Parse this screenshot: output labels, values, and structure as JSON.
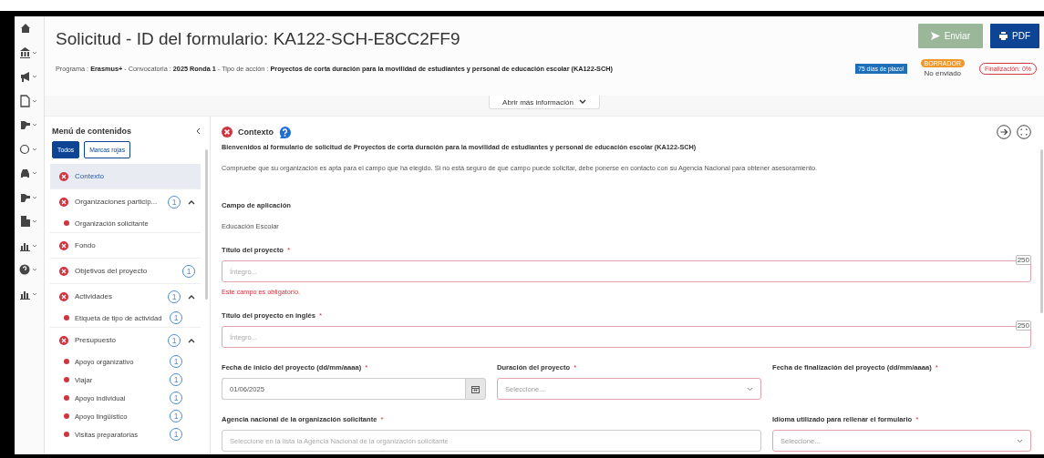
{
  "page": {
    "title": "Solicitud - ID del formulario: KA122-SCH-E8CC2FF9"
  },
  "actions": [
    {
      "label": "Enviar",
      "kind": "send",
      "disabled": true
    },
    {
      "label": "PDF",
      "kind": "pdf",
      "disabled": false
    }
  ],
  "info_line": "Programa : **Erasmus+** - Convocatoria : **2025 Ronda 1** - Tipo de acción : **Proyectos de corta duración para la movilidad de estudiantes y personal de educación escolar (KA122-SCH)**",
  "deadline_badge": "75 días de plazo!",
  "status": {
    "badge": "BORRADOR",
    "text": "No enviado"
  },
  "completion": "Finalización: 0%",
  "more_info_button": "Abrir más información",
  "menu": {
    "title": "Menú de contenidos",
    "filters": [
      {
        "label": "Todos",
        "selected": true
      },
      {
        "label": "Marcas rojas",
        "selected": false
      }
    ],
    "items": [
      {
        "label": "Contexto",
        "selected": true,
        "invalid": true
      },
      {
        "label": "Organizaciones particip...",
        "selected": false,
        "invalid": true,
        "count": "1",
        "expanded": true,
        "children": [
          {
            "label": "Organización solicitante",
            "invalid": true
          }
        ]
      },
      {
        "label": "Fondo",
        "selected": false,
        "invalid": true
      },
      {
        "label": "Objetivos del proyecto",
        "selected": false,
        "invalid": true,
        "count": "1"
      },
      {
        "label": "Actividades",
        "selected": false,
        "invalid": true,
        "count": "1",
        "expanded": true,
        "children": [
          {
            "label": "Etiqueta de tipo de actividad",
            "invalid": true,
            "count": "1"
          }
        ]
      },
      {
        "label": "Presupuesto",
        "selected": false,
        "invalid": true,
        "count": "1",
        "expanded": true,
        "children": [
          {
            "label": "Apoyo organizativo",
            "invalid": true,
            "count": "1"
          },
          {
            "label": "Viajar",
            "invalid": true,
            "count": "1"
          },
          {
            "label": "Apoyo individual",
            "invalid": true,
            "count": "1"
          },
          {
            "label": "Apoyo lingüístico",
            "invalid": true,
            "count": "1"
          },
          {
            "label": "Visitas preparatorias",
            "invalid": true,
            "count": "1"
          }
        ]
      }
    ]
  },
  "section": {
    "title": "Contexto",
    "invalid": true,
    "intro": "Bienvenidos al formulario de solicitud de Proyectos de corta duración para la movilidad de estudiantes y personal de educación escolar (KA122-SCH)",
    "note": "Compruebe que su organización es apta para el campo que ha elegido. Si no está seguro de qué campo puede solicitar, debe ponerse en contacto con su Agencia Nacional para obtener asesoramiento.",
    "field_of_application": {
      "label": "Campo de aplicación",
      "value": "Educación Escolar"
    },
    "field_rows": [
      [
        {
          "kind": "text",
          "label": "Título del proyecto",
          "required_mark": "*",
          "placeholder": "Íntegro...",
          "counter": "250",
          "invalid": true,
          "error": "Este campo es obligatorio."
        }
      ],
      [
        {
          "kind": "text",
          "label": "Título del proyecto en inglés",
          "required_mark": "*",
          "placeholder": "Íntegro...",
          "counter": "250",
          "invalid": true
        }
      ],
      [
        {
          "kind": "date",
          "label": "Fecha de inicio del proyecto (dd/mm/aaaa)",
          "required_mark": "*",
          "value": "01/06/2025",
          "invalid": false
        },
        {
          "kind": "select",
          "label": "Duración del proyecto",
          "required_mark": "*",
          "placeholder": "Seleccione...",
          "invalid": true
        },
        {
          "kind": "label",
          "label": "Fecha de finalización del proyecto (dd/mm/aaaa)",
          "required_mark": "*"
        }
      ],
      [
        {
          "kind": "text",
          "label": "Agencia nacional de la organización solicitante",
          "required_mark": "*",
          "placeholder": "Seleccione en la lista la Agencia Nacional de la organización solicitante",
          "invalid": false
        },
        {
          "kind": "select",
          "label": "Idioma utilizado para rellenar el formulario",
          "required_mark": "*",
          "placeholder": "Seleccione...",
          "invalid": true
        }
      ]
    ]
  }
}
